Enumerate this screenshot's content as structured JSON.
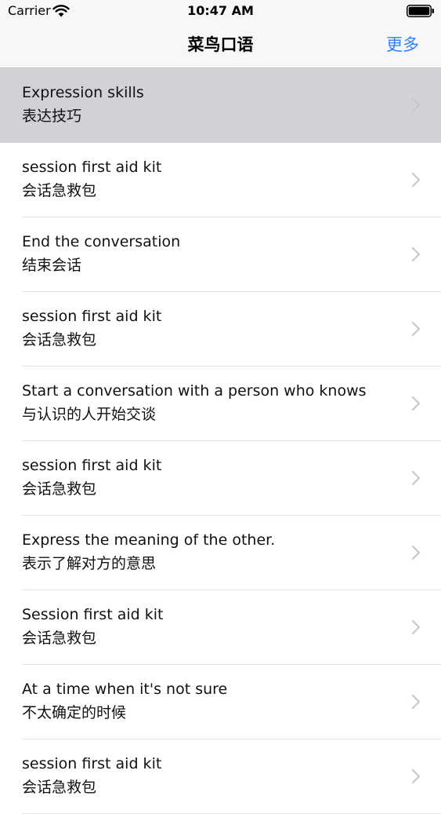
{
  "status_bar": {
    "carrier": "Carrier",
    "time": "10:47 AM",
    "icons": [
      "wifi-icon",
      "battery-icon"
    ]
  },
  "nav": {
    "title": "菜鸟口语",
    "right_button": "更多"
  },
  "colors": {
    "accent": "#2f80ff",
    "selected_row": "#d1d1d6",
    "bar_background": "#f7f7f7",
    "separator": "#e3e3e6",
    "chevron": "#c7c7cc"
  },
  "list": {
    "items": [
      {
        "title": "Expression skills",
        "subtitle": "表达技巧",
        "selected": true
      },
      {
        "title": "session first aid kit",
        "subtitle": "会话急救包"
      },
      {
        "title": "End the conversation",
        "subtitle": "结束会话"
      },
      {
        "title": "session first aid kit",
        "subtitle": "会话急救包"
      },
      {
        "title": "Start a conversation with a person who knows",
        "subtitle": "与认识的人开始交谈"
      },
      {
        "title": "session first aid kit",
        "subtitle": "会话急救包"
      },
      {
        "title": "Express the meaning of the other.",
        "subtitle": "表示了解对方的意思"
      },
      {
        "title": "Session first aid kit",
        "subtitle": "会话急救包"
      },
      {
        "title": "At a time when it's not sure",
        "subtitle": "不太确定的时候"
      },
      {
        "title": "session first aid kit",
        "subtitle": "会话急救包"
      }
    ]
  }
}
